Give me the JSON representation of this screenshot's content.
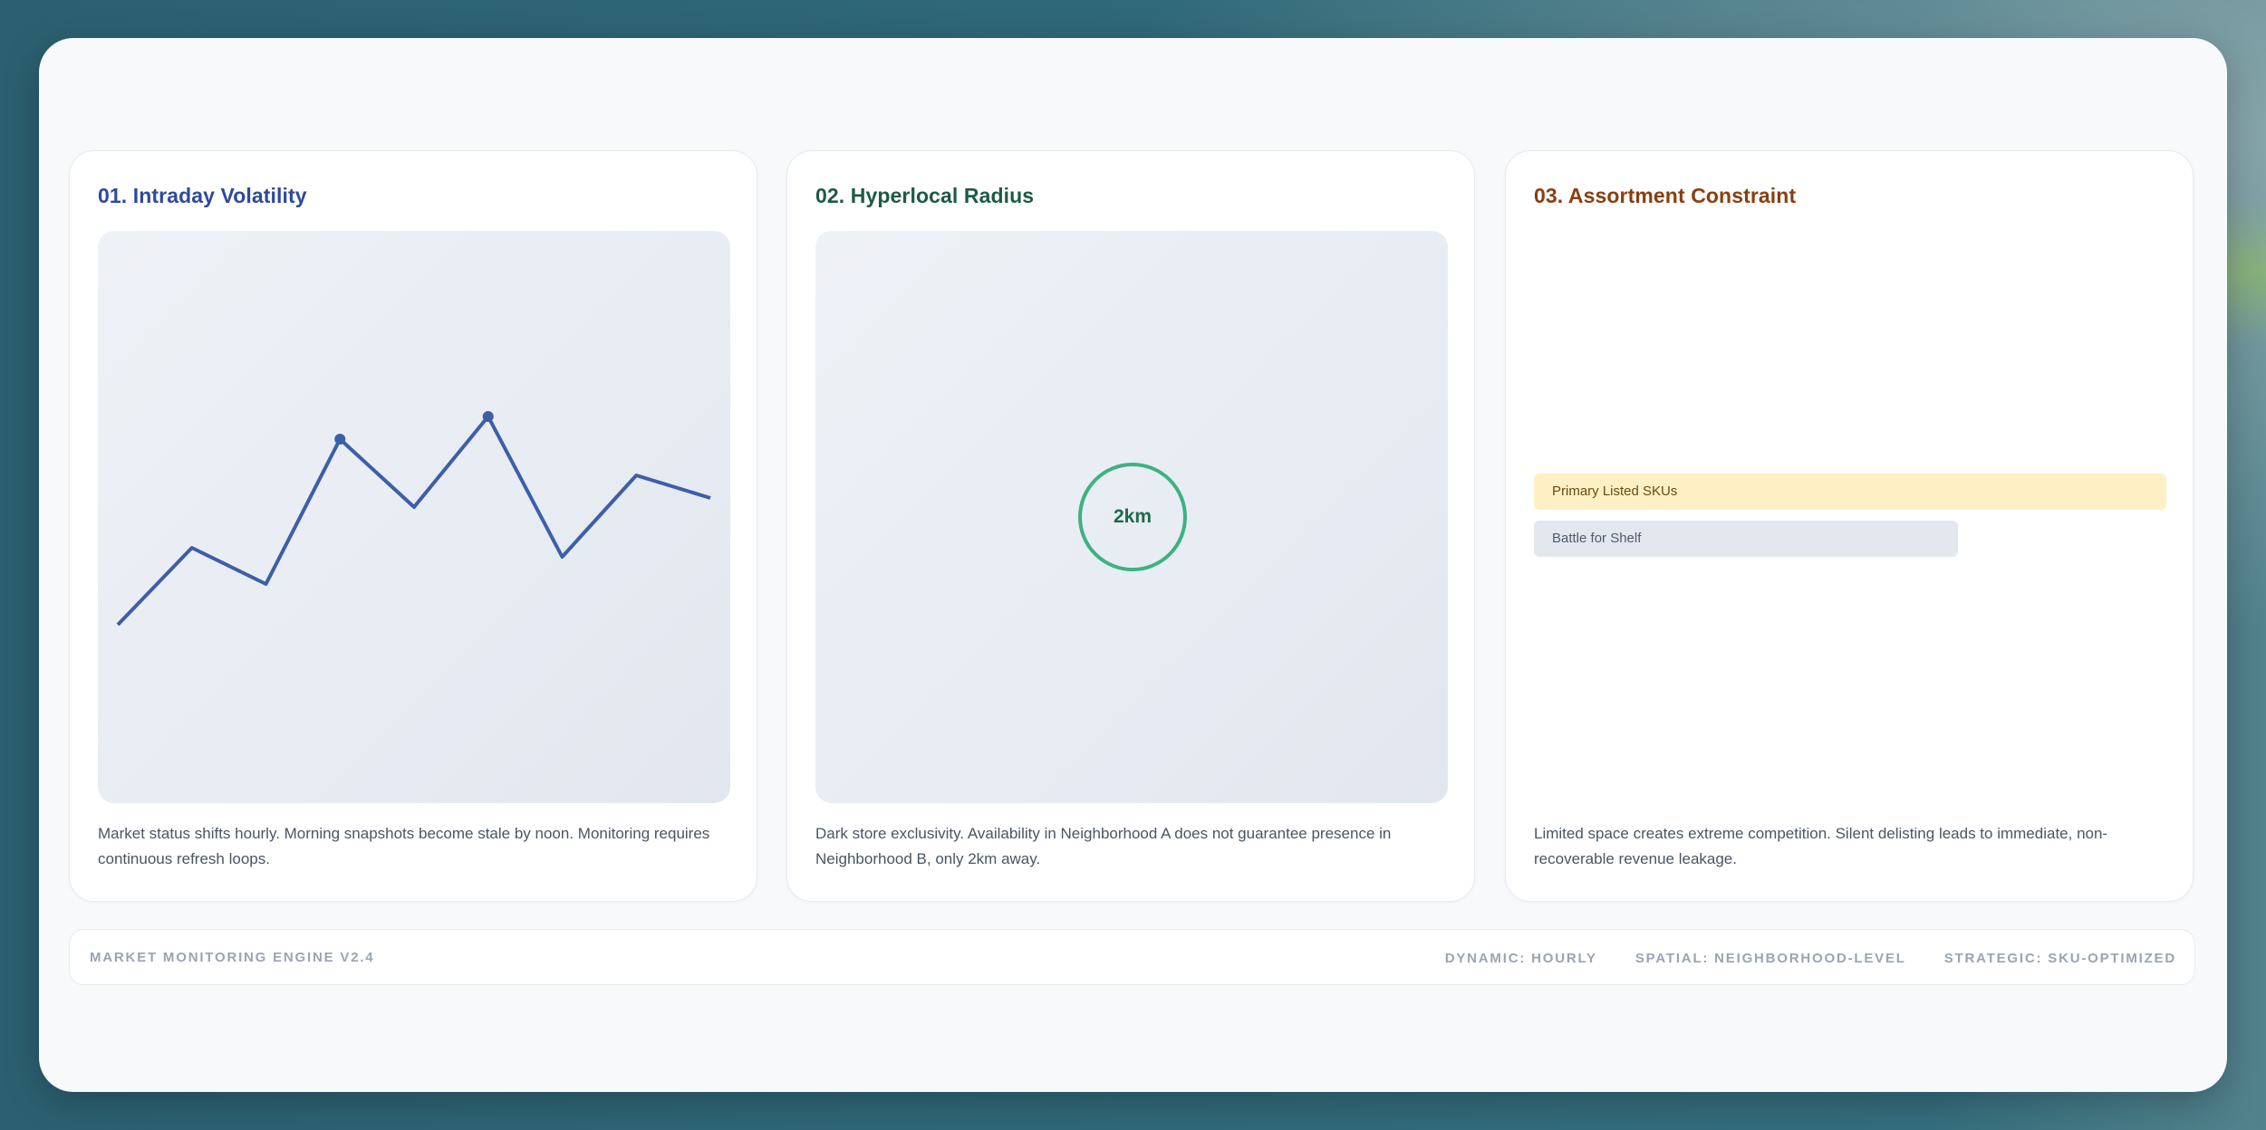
{
  "cards": [
    {
      "title": "01. Intraday Volatility",
      "description": "Market status shifts hourly. Morning snapshots become stale by noon. Monitoring requires continuous refresh loops."
    },
    {
      "title": "02. Hyperlocal Radius",
      "radius_label": "2km",
      "description": "Dark store exclusivity. Availability in Neighborhood A does not guarantee presence in Neighborhood B, only 2km away."
    },
    {
      "title": "03. Assortment Constraint",
      "bars": [
        {
          "label": "Primary Listed SKUs",
          "fill": 1.0
        },
        {
          "label": "Battle for Shelf",
          "fill": 0.67
        }
      ],
      "description": "Limited space creates extreme competition. Silent delisting leads to immediate, non-recoverable revenue leakage."
    }
  ],
  "footer": {
    "engine_label": "MARKET MONITORING ENGINE V2.4",
    "tags": [
      "DYNAMIC: HOURLY",
      "SPATIAL: NEIGHBORHOOD-LEVEL",
      "STRATEGIC: SKU-OPTIMIZED"
    ]
  },
  "colors": {
    "card1_accent": "#2e4a9a",
    "card2_accent": "#1d5a45",
    "card3_accent": "#8a3e0e",
    "line_color": "#3c5fa8",
    "ring_color": "#3db27e",
    "bar_primary": "#fdf0c4",
    "bar_secondary": "#e3e8ef"
  },
  "volatility_series": {
    "values": [
      2.5,
      4.2,
      3.4,
      6.6,
      5.1,
      7.1,
      4.0,
      5.8,
      5.3
    ],
    "highlighted_points": [
      3,
      5
    ]
  }
}
